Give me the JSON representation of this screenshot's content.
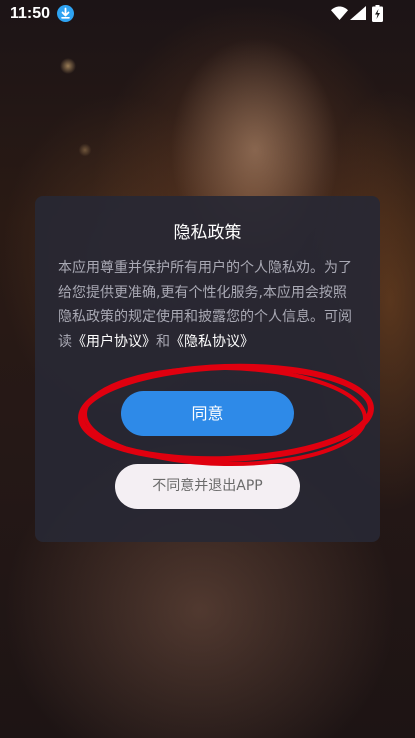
{
  "status_bar": {
    "time": "11:50",
    "icons": [
      "download-icon",
      "wifi-icon",
      "signal-icon",
      "battery-icon"
    ]
  },
  "dialog": {
    "title": "隐私政策",
    "body_prefix": "本应用尊重并保护所有用户的个人隐私劝。为了给您提供更准确,更有个性化服务,本应用会按照隐私政策的规定使用和披露您的个人信息。可阅读",
    "link_user_agreement": "《用户协议》",
    "connector": "和",
    "link_privacy_agreement": "《隐私协议》",
    "agree_label": "同意",
    "disagree_label": "不同意并退出APP"
  },
  "colors": {
    "accent": "#2e8ae8",
    "dialog_bg": "#28283a",
    "annotation": "#e0000f"
  }
}
